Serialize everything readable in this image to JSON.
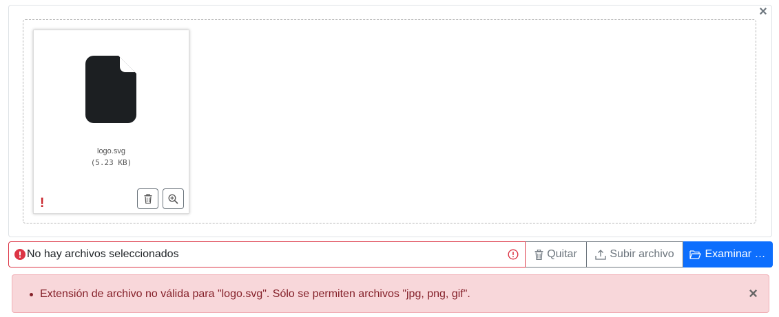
{
  "preview": {
    "close_glyph": "×",
    "file": {
      "name": "logo.svg",
      "size": "(5.23 KB)",
      "error_mark": "!"
    }
  },
  "input": {
    "caption": "No hay archivos seleccionados",
    "remove_label": "Quitar",
    "upload_label": "Subir archivo",
    "browse_label": "Examinar …"
  },
  "alert": {
    "message": "Extensión de archivo no válida para \"logo.svg\". Sólo se permiten archivos \"jpg, png, gif\".",
    "close_glyph": "×"
  },
  "colors": {
    "danger": "#dc3545",
    "primary": "#0d6efd",
    "alert_bg": "#f8d7da",
    "alert_text": "#842029"
  },
  "icons": {
    "file": "file-icon",
    "trash": "trash-icon",
    "zoom": "zoom-in-icon",
    "upload": "upload-icon",
    "folder": "folder-open-icon",
    "error": "exclamation-circle-icon"
  }
}
